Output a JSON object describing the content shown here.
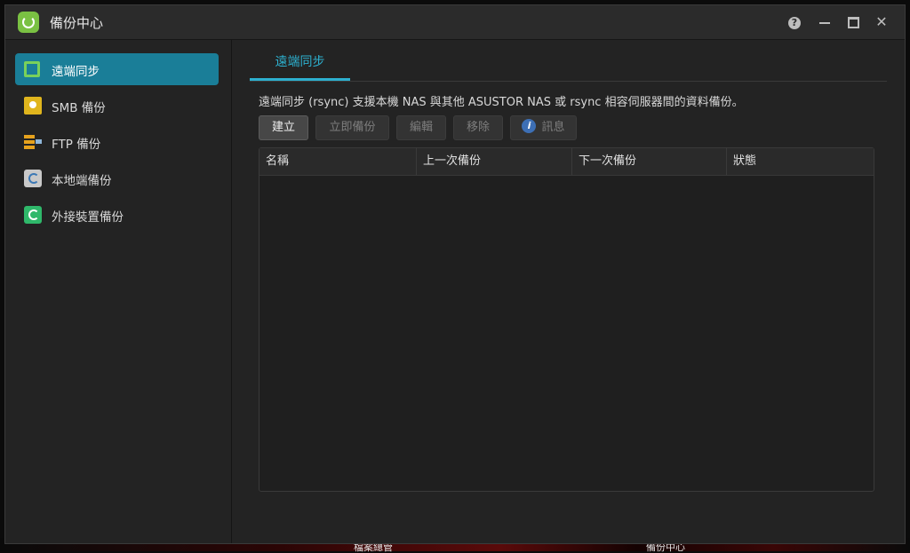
{
  "window": {
    "title": "備份中心",
    "controls": {
      "help": "?",
      "close": "✕"
    }
  },
  "sidebar": {
    "items": [
      {
        "label": "遠端同步",
        "icon": "rsync-icon",
        "active": true
      },
      {
        "label": "SMB 備份",
        "icon": "smb-folder-icon",
        "active": false
      },
      {
        "label": "FTP 備份",
        "icon": "ftp-server-icon",
        "active": false
      },
      {
        "label": "本地端備份",
        "icon": "local-disk-icon",
        "active": false
      },
      {
        "label": "外接裝置備份",
        "icon": "external-drive-icon",
        "active": false
      }
    ]
  },
  "main": {
    "tab": "遠端同步",
    "description": "遠端同步 (rsync) 支援本機 NAS 與其他 ASUSTOR NAS 或 rsync 相容伺服器間的資料備份。",
    "toolbar": {
      "create": "建立",
      "backup_now": "立即備份",
      "edit": "編輯",
      "remove": "移除",
      "info": "訊息",
      "info_icon_glyph": "i"
    },
    "table": {
      "columns": [
        "名稱",
        "上一次備份",
        "下一次備份",
        "狀態"
      ],
      "rows": []
    }
  },
  "taskbar": {
    "items": [
      "檔案總管",
      "備份中心"
    ]
  },
  "colors": {
    "accent": "#1a7e98",
    "tab_accent": "#2db0cf",
    "window_bg": "#232323"
  }
}
